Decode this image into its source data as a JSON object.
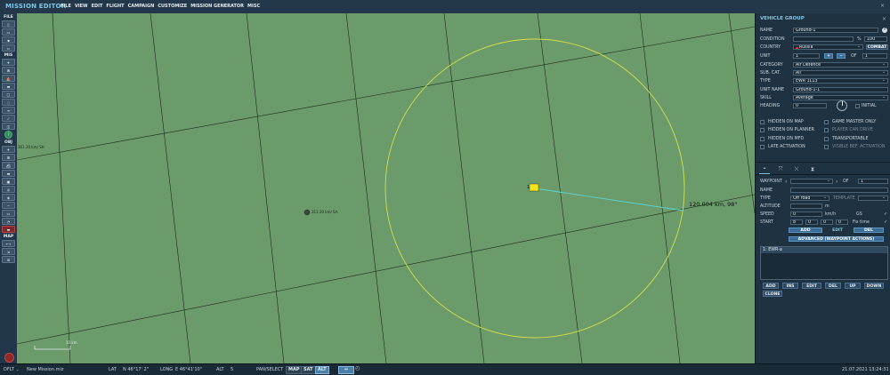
{
  "app": {
    "title": "MISSION EDITOR",
    "close": "×"
  },
  "menu": [
    "FILE",
    "VIEW",
    "EDIT",
    "FLIGHT",
    "CAMPAIGN",
    "CUSTOMIZE",
    "MISSION GENERATOR",
    "MISC"
  ],
  "toolbar": {
    "file_label": "FILE",
    "mis_label": "MIS",
    "obj_label": "OBJ",
    "map_label": "MAP"
  },
  "map": {
    "unit_label": "1",
    "distance_label": "120.004 km, 98°",
    "marker_label": "311.30 km/ SA",
    "edge_label": "361.30 km/ SH",
    "scale_label": "10 km",
    "colors": {
      "land": "#6b9a6b",
      "circle": "#d6e04a",
      "route": "#5fd6d0",
      "grid": "#1a2a1a",
      "unit": "#f5e61c"
    }
  },
  "status": {
    "mode": "DFLT",
    "mode_arrow": "⌄",
    "file": "New Mission.miz",
    "lat_label": "LAT",
    "lat": "N 46°17' 2\"",
    "long_label": "LONG",
    "long": "E 46°41'10\"",
    "alt_label": "ALT",
    "alt": "5",
    "pan": "PAN/SELECT",
    "map_btn": "MAP",
    "sat_btn": "SAT",
    "alt_btn": "ALT",
    "datetime": "21.07.2021 13:24:31"
  },
  "panel": {
    "title": "VEHICLE GROUP",
    "close": "×",
    "name_label": "NAME",
    "name_value": "Ground-1",
    "help": "?",
    "condition_label": "CONDITION",
    "condition_pct": "%",
    "condition_value": "100",
    "country_label": "COUNTRY",
    "country_value": "Russia",
    "combat_btn": "COMBAT",
    "unit_label": "UNIT",
    "unit_value": "1",
    "unit_add": "+",
    "unit_remove": "−",
    "of_label": "OF",
    "unit_total": "1",
    "category_label": "CATEGORY",
    "category_value": "Air Defence",
    "subcat_label": "SUB. CAT.",
    "subcat_value": "All",
    "type_label": "TYPE",
    "type_value": "EWR 1L13",
    "unitname_label": "UNIT NAME",
    "unitname_value": "Ground-1-1",
    "skill_label": "SKILL",
    "skill_value": "Average",
    "heading_label": "HEADING",
    "heading_value": "0",
    "initial_label": "INITIAL",
    "checks": [
      {
        "label": "HIDDEN ON MAP",
        "dim": false
      },
      {
        "label": "GAME MASTER ONLY",
        "dim": false
      },
      {
        "label": "HIDDEN ON PLANNER",
        "dim": false
      },
      {
        "label": "PLAYER CAN DRIVE",
        "dim": true
      },
      {
        "label": "HIDDEN ON MFD",
        "dim": false
      },
      {
        "label": "TRANSPORTABLE",
        "dim": false
      },
      {
        "label": "LATE ACTIVATION",
        "dim": false
      },
      {
        "label": "VISIBLE BEF. ACTIVATION",
        "dim": true
      }
    ],
    "waypoint_label": "WAYPOINT",
    "waypoint_of": "OF",
    "waypoint_total": "1",
    "wp_name_label": "NAME",
    "wp_type_label": "TYPE",
    "wp_type_value": "Off road",
    "template_label": "TEMPLATE",
    "altitude_label": "ALTITUDE",
    "altitude_unit": "m",
    "speed_label": "SPEED",
    "speed_value": "0",
    "speed_unit": "km/h",
    "gs_label": "GS",
    "start_label": "START",
    "start_h": "8",
    "start_m": "0",
    "start_s": "0",
    "start_d": "0",
    "fixtime_label": "Fix time",
    "wp_add": "ADD",
    "wp_edit": "EDIT",
    "wp_del": "DEL",
    "advanced": "ADVANCED (WAYPOINT ACTIONS)",
    "list_item": "1: EWR-a",
    "bottom": [
      "ADD",
      "INS",
      "EDIT",
      "DEL",
      "UP",
      "DOWN",
      "CLONE"
    ]
  }
}
